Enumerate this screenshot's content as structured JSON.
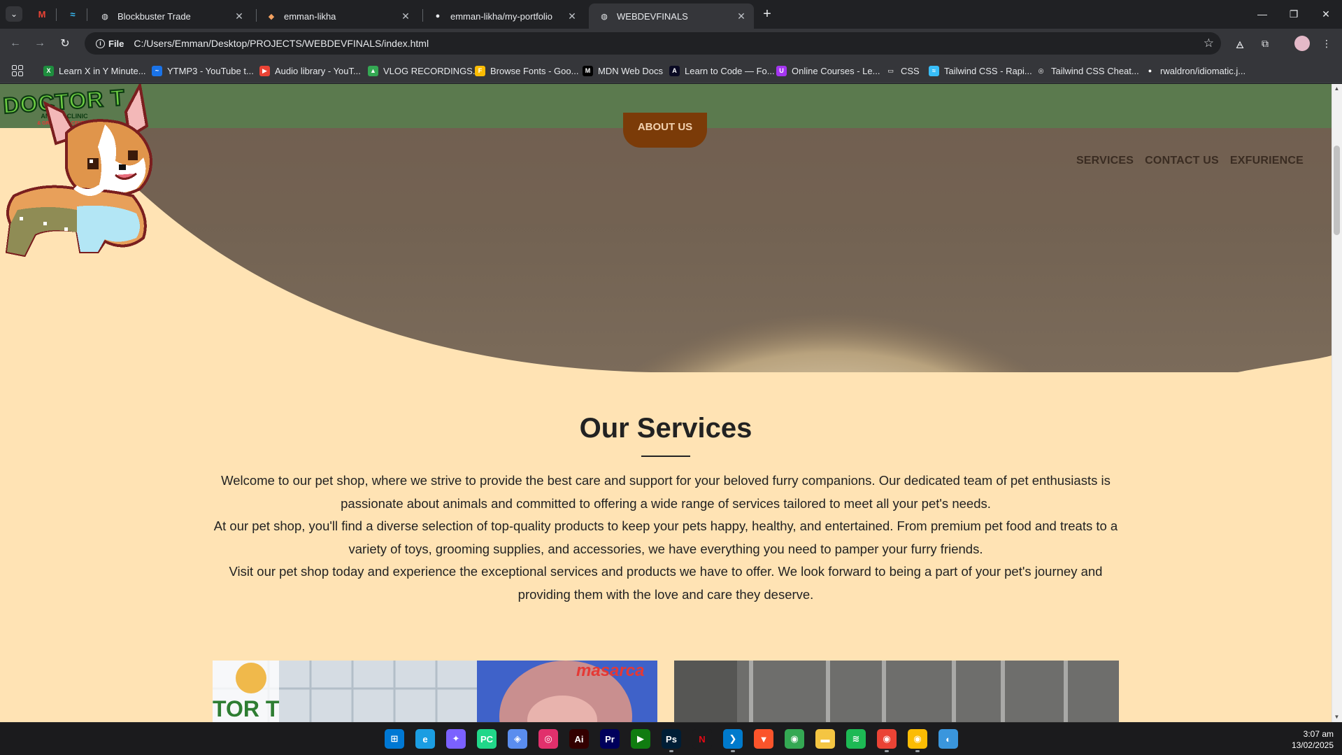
{
  "browser": {
    "tabs": [
      {
        "title": "Blockbuster Trade",
        "favicon": "globe-icon"
      },
      {
        "title": "emman-likha",
        "favicon": "likha-icon"
      },
      {
        "title": "emman-likha/my-portfolio",
        "favicon": "github-icon"
      },
      {
        "title": "WEBDEVFINALS",
        "favicon": "globe-icon",
        "active": true
      }
    ],
    "pinned": [
      "gmail-icon",
      "tailwind-icon"
    ],
    "address": {
      "chip": "File",
      "url": "C:/Users/Emman/Desktop/PROJECTS/WEBDEVFINALS/index.html"
    },
    "bookmarks": [
      {
        "label": "Learn X in Y Minute...",
        "color": "#1e8e3e",
        "glyph": "X"
      },
      {
        "label": "YTMP3 - YouTube t...",
        "color": "#1a73e8",
        "glyph": "~"
      },
      {
        "label": "Audio library - YouT...",
        "color": "#ea4335",
        "glyph": "▶"
      },
      {
        "label": "VLOG RECORDINGS...",
        "color": "#34a853",
        "glyph": "▲"
      },
      {
        "label": "Browse Fonts - Goo...",
        "color": "#fbbc04",
        "glyph": "F"
      },
      {
        "label": "MDN Web Docs",
        "color": "#000000",
        "glyph": "M"
      },
      {
        "label": "Learn to Code — Fo...",
        "color": "#0a0a23",
        "glyph": "A"
      },
      {
        "label": "Online Courses - Le...",
        "color": "#a435f0",
        "glyph": "U"
      },
      {
        "label": "CSS",
        "color": "#35363a",
        "glyph": "▭"
      },
      {
        "label": "Tailwind CSS - Rapi...",
        "color": "#38bdf8",
        "glyph": "≈"
      },
      {
        "label": "Tailwind CSS Cheat...",
        "color": "#35363a",
        "glyph": "◎"
      },
      {
        "label": "rwaldron/idiomatic.j...",
        "color": "#35363a",
        "glyph": "●"
      }
    ]
  },
  "site": {
    "logo_text": "DOCTOR T",
    "logo_sub1": "ANIMAL CLINIC",
    "logo_sub2": "& GROOMING CENTER",
    "about_button": "ABOUT US",
    "nav": [
      "SERVICES",
      "CONTACT US",
      "EXFURIENCE"
    ],
    "services": {
      "title": "Our Services",
      "paragraphs": [
        "Welcome to our pet shop, where we strive to provide the best care and support for your beloved furry companions. Our dedicated team of pet enthusiasts is passionate about animals and committed to offering a wide range of services tailored to meet all your pet's needs.",
        "At our pet shop, you'll find a diverse selection of top-quality products to keep your pets happy, healthy, and entertained. From premium pet food and treats to a variety of toys, grooming supplies, and accessories, we have everything you need to pamper your furry friends.",
        "Visit our pet shop today and experience the exceptional services and products we have to offer. We look forward to being a part of your pet's journey and providing them with the love and care they deserve."
      ]
    },
    "card_snippets": {
      "logo_fragment": "TOR T",
      "sign_fragment": "masarca"
    }
  },
  "taskbar": {
    "time": "3:07 am",
    "date": "13/02/2025",
    "apps": [
      "windows-start-icon",
      "edge-icon",
      "copilot-icon",
      "pycharm-icon",
      "cube-icon",
      "instagram-icon",
      "illustrator-icon",
      "premiere-icon",
      "gamepass-icon",
      "photoshop-icon",
      "netflix-icon",
      "vscode-icon",
      "brave-icon",
      "chrome-icon",
      "file-explorer-icon",
      "spotify-icon",
      "chrome-profile-icon",
      "chrome-alt-icon",
      "network-icon"
    ]
  },
  "colors": {
    "header_green": "#5b7a4e",
    "page_bg": "#ffe3b4",
    "about_brown": "#7b3b08"
  }
}
